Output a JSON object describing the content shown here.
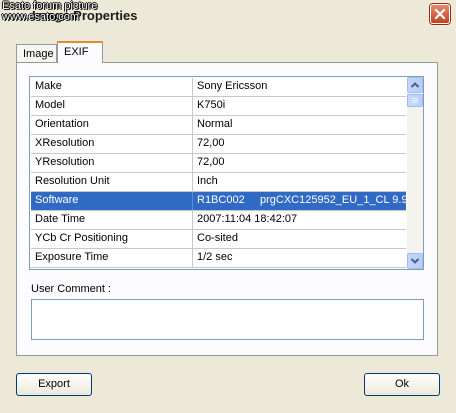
{
  "window": {
    "title": "Image Properties",
    "watermark_line1": "Esato forum picture",
    "watermark_line2": "www.esato.com"
  },
  "tabs": [
    {
      "label": "Image",
      "active": false
    },
    {
      "label": "EXIF",
      "active": true
    }
  ],
  "exif": {
    "rows": [
      {
        "key": "Make",
        "value": "Sony Ericsson"
      },
      {
        "key": "Model",
        "value": "K750i"
      },
      {
        "key": "Orientation",
        "value": "Normal"
      },
      {
        "key": "XResolution",
        "value": "72,00"
      },
      {
        "key": "YResolution",
        "value": "72,00"
      },
      {
        "key": "Resolution Unit",
        "value": "Inch"
      },
      {
        "key": "Software",
        "value": "R1BC002     prgCXC125952_EU_1_CL 9.9",
        "selected": true
      },
      {
        "key": "Date Time",
        "value": "2007:11:04 18:42:07"
      },
      {
        "key": "YCb Cr Positioning",
        "value": "Co-sited"
      },
      {
        "key": "Exposure Time",
        "value": "1/2 sec"
      }
    ]
  },
  "comment": {
    "label": "User Comment :",
    "value": ""
  },
  "buttons": {
    "export_label": "Export",
    "ok_label": "Ok"
  },
  "icons": {
    "close": "close-icon",
    "scroll_up": "scroll-up-icon",
    "scroll_down": "scroll-down-icon"
  },
  "colors": {
    "selection": "#316ac5",
    "close_button": "#c4411f",
    "active_tab_accent": "#e68b2c"
  }
}
